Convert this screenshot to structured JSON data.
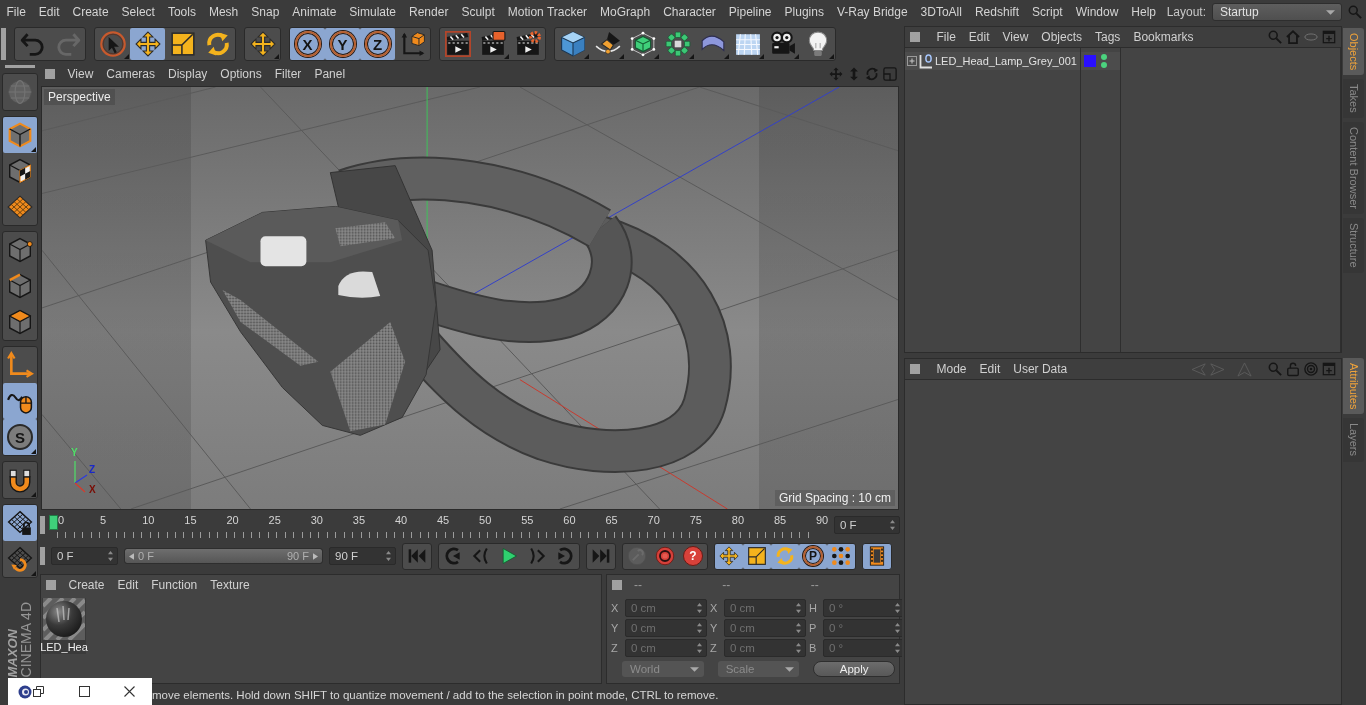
{
  "menu_bar": {
    "items": [
      "File",
      "Edit",
      "Create",
      "Select",
      "Tools",
      "Mesh",
      "Snap",
      "Animate",
      "Simulate",
      "Render",
      "Sculpt",
      "Motion Tracker",
      "MoGraph",
      "Character",
      "Pipeline",
      "Plugins",
      "V-Ray Bridge",
      "3DToAll",
      "Redshift",
      "Script",
      "Window",
      "Help"
    ],
    "layout_label": "Layout:",
    "layout_value": "Startup"
  },
  "toolbar": {
    "groups": [
      {
        "items": [
          {
            "kind": "undo",
            "selected": false,
            "disabled": false,
            "menu": false
          },
          {
            "kind": "redo",
            "selected": false,
            "disabled": true,
            "menu": false
          }
        ]
      },
      {
        "items": [
          {
            "kind": "live_select",
            "selected": false,
            "disabled": false,
            "menu": true
          },
          {
            "kind": "move",
            "selected": true,
            "disabled": false,
            "menu": false
          },
          {
            "kind": "scale",
            "selected": false,
            "disabled": false,
            "menu": false
          },
          {
            "kind": "rotate",
            "selected": false,
            "disabled": false,
            "menu": false
          }
        ]
      },
      {
        "items": [
          {
            "kind": "move",
            "selected": false,
            "disabled": false,
            "menu": true
          }
        ]
      },
      {
        "items": [
          {
            "kind": "axis_lock",
            "label": "X",
            "selected": true,
            "disabled": false,
            "menu": false
          },
          {
            "kind": "axis_lock",
            "label": "Y",
            "selected": true,
            "disabled": false,
            "menu": false
          },
          {
            "kind": "axis_lock",
            "label": "Z",
            "selected": true,
            "disabled": false,
            "menu": false
          },
          {
            "kind": "coordinate_system",
            "selected": false,
            "disabled": false,
            "menu": false
          }
        ]
      },
      {
        "items": [
          {
            "kind": "render_view",
            "selected": false,
            "disabled": false,
            "menu": false
          },
          {
            "kind": "render_picture_viewer",
            "selected": false,
            "disabled": false,
            "menu": true
          },
          {
            "kind": "render_settings",
            "selected": false,
            "disabled": false,
            "menu": false
          }
        ]
      },
      {
        "items": [
          {
            "kind": "cube",
            "selected": false,
            "disabled": false,
            "menu": true
          },
          {
            "kind": "pen",
            "selected": false,
            "disabled": false,
            "menu": true
          },
          {
            "kind": "subdivision",
            "selected": false,
            "disabled": false,
            "menu": true
          },
          {
            "kind": "cloner",
            "selected": false,
            "disabled": false,
            "menu": true
          },
          {
            "kind": "bend",
            "selected": false,
            "disabled": false,
            "menu": true
          },
          {
            "kind": "floor",
            "selected": false,
            "disabled": false,
            "menu": true
          },
          {
            "kind": "camera",
            "selected": false,
            "disabled": false,
            "menu": true
          },
          {
            "kind": "light",
            "selected": false,
            "disabled": false,
            "menu": true
          }
        ]
      }
    ]
  },
  "mode_toolbar": {
    "groups": [
      {
        "items": [
          {
            "kind": "make_editable",
            "selected": false,
            "disabled": true,
            "menu": false
          }
        ]
      },
      {
        "items": [
          {
            "kind": "model",
            "selected": true,
            "disabled": false,
            "menu": true
          },
          {
            "kind": "texture",
            "selected": false,
            "disabled": false,
            "menu": false
          },
          {
            "kind": "workplane",
            "selected": false,
            "disabled": false,
            "menu": false
          }
        ]
      },
      {
        "items": [
          {
            "kind": "points",
            "selected": false,
            "disabled": false,
            "menu": false
          },
          {
            "kind": "edges",
            "selected": false,
            "disabled": false,
            "menu": false
          },
          {
            "kind": "polygons",
            "selected": false,
            "disabled": false,
            "menu": false
          }
        ]
      },
      {
        "items": [
          {
            "kind": "axis",
            "selected": false,
            "disabled": false,
            "menu": false
          },
          {
            "kind": "tweak",
            "selected": true,
            "disabled": false,
            "menu": false
          },
          {
            "kind": "solo",
            "label": "S",
            "selected": true,
            "disabled": false,
            "menu": true
          }
        ]
      },
      {
        "items": [
          {
            "kind": "snap",
            "selected": false,
            "disabled": false,
            "menu": true
          }
        ]
      },
      {
        "items": [
          {
            "kind": "workplane_lock",
            "selected": true,
            "disabled": false,
            "menu": false
          },
          {
            "kind": "workplane_align",
            "selected": false,
            "disabled": false,
            "menu": true
          }
        ]
      }
    ]
  },
  "viewport": {
    "menu": [
      "View",
      "Cameras",
      "Display",
      "Options",
      "Filter",
      "Panel"
    ],
    "camera": "Perspective",
    "axis_labels": [
      "Y",
      "Z",
      "X"
    ],
    "grid_spacing": "Grid Spacing : 10 cm"
  },
  "timeline": {
    "frame_labels": [
      "0",
      "5",
      "10",
      "15",
      "20",
      "25",
      "30",
      "35",
      "40",
      "45",
      "50",
      "55",
      "60",
      "65",
      "70",
      "75",
      "80",
      "85",
      "90"
    ],
    "playhead": {
      "level": 0
    },
    "current_frame": "0 F"
  },
  "transport": {
    "start_frame": "0 F",
    "range_slider": {
      "start": "0 F",
      "end": "90 F",
      "level": 1
    },
    "end_frame": "90 F",
    "groups": [
      {
        "items": [
          {
            "kind": "go_start",
            "selected": false,
            "disabled": false
          }
        ]
      },
      {
        "items": [
          {
            "kind": "prev_key",
            "selected": false,
            "disabled": false
          },
          {
            "kind": "prev_frame",
            "selected": false,
            "disabled": false
          },
          {
            "kind": "play",
            "selected": false,
            "disabled": false
          },
          {
            "kind": "next_frame",
            "selected": false,
            "disabled": false
          },
          {
            "kind": "next_key",
            "selected": false,
            "disabled": false
          }
        ]
      },
      {
        "items": [
          {
            "kind": "go_end",
            "selected": false,
            "disabled": false
          }
        ]
      },
      {
        "items": [
          {
            "kind": "record",
            "selected": false,
            "disabled": true
          },
          {
            "kind": "autokey",
            "selected": false,
            "disabled": false
          },
          {
            "kind": "key_selection",
            "label": "?",
            "selected": false,
            "disabled": false
          }
        ]
      },
      {
        "items": [
          {
            "kind": "key_move",
            "selected": true,
            "disabled": false
          },
          {
            "kind": "key_scale",
            "selected": true,
            "disabled": false
          },
          {
            "kind": "key_rotate",
            "selected": true,
            "disabled": false
          },
          {
            "kind": "param",
            "label": "P",
            "selected": true,
            "disabled": false
          },
          {
            "kind": "key_pla",
            "selected": true,
            "disabled": false
          }
        ]
      },
      {
        "items": [
          {
            "kind": "timeline",
            "selected": true,
            "disabled": false
          }
        ]
      }
    ]
  },
  "material_manager": {
    "menu": [
      "Create",
      "Edit",
      "Function",
      "Texture"
    ],
    "materials": [
      {
        "name": "LED_Hea"
      }
    ]
  },
  "coordinates": {
    "headers": [
      "--",
      "--",
      "--"
    ],
    "rows": [
      [
        {
          "axis": "X",
          "value": "0 cm"
        },
        {
          "axis": "X",
          "value": "0 cm"
        },
        {
          "axis": "H",
          "value": "0 °"
        }
      ],
      [
        {
          "axis": "Y",
          "value": "0 cm"
        },
        {
          "axis": "Y",
          "value": "0 cm"
        },
        {
          "axis": "P",
          "value": "0 °"
        }
      ],
      [
        {
          "axis": "Z",
          "value": "0 cm"
        },
        {
          "axis": "Z",
          "value": "0 cm"
        },
        {
          "axis": "B",
          "value": "0 °"
        }
      ]
    ],
    "dropdowns": [
      "World",
      "Scale"
    ],
    "apply": "Apply"
  },
  "status_bar": {
    "text": "move elements. Hold down SHIFT to quantize movement / add to the selection in point mode, CTRL to remove."
  },
  "object_manager": {
    "menu": [
      "File",
      "Edit",
      "View",
      "Objects",
      "Tags",
      "Bookmarks"
    ],
    "objects": [
      {
        "name": "LED_Head_Lamp_Grey_001",
        "expanded": false,
        "color": "#2a10ff"
      }
    ]
  },
  "attribute_manager": {
    "menu": [
      "Mode",
      "Edit",
      "User Data"
    ]
  },
  "side_tabs": {
    "upper": [
      {
        "label": "Objects",
        "selected": true
      },
      {
        "label": "Takes",
        "selected": false
      },
      {
        "label": "Content Browser",
        "selected": false
      },
      {
        "label": "Structure",
        "selected": false
      }
    ],
    "lower": [
      {
        "label": "Attributes",
        "selected": true
      },
      {
        "label": "Layers",
        "selected": false
      }
    ]
  },
  "logo": {
    "brand": "MAXON",
    "product": "CINEMA 4D"
  }
}
